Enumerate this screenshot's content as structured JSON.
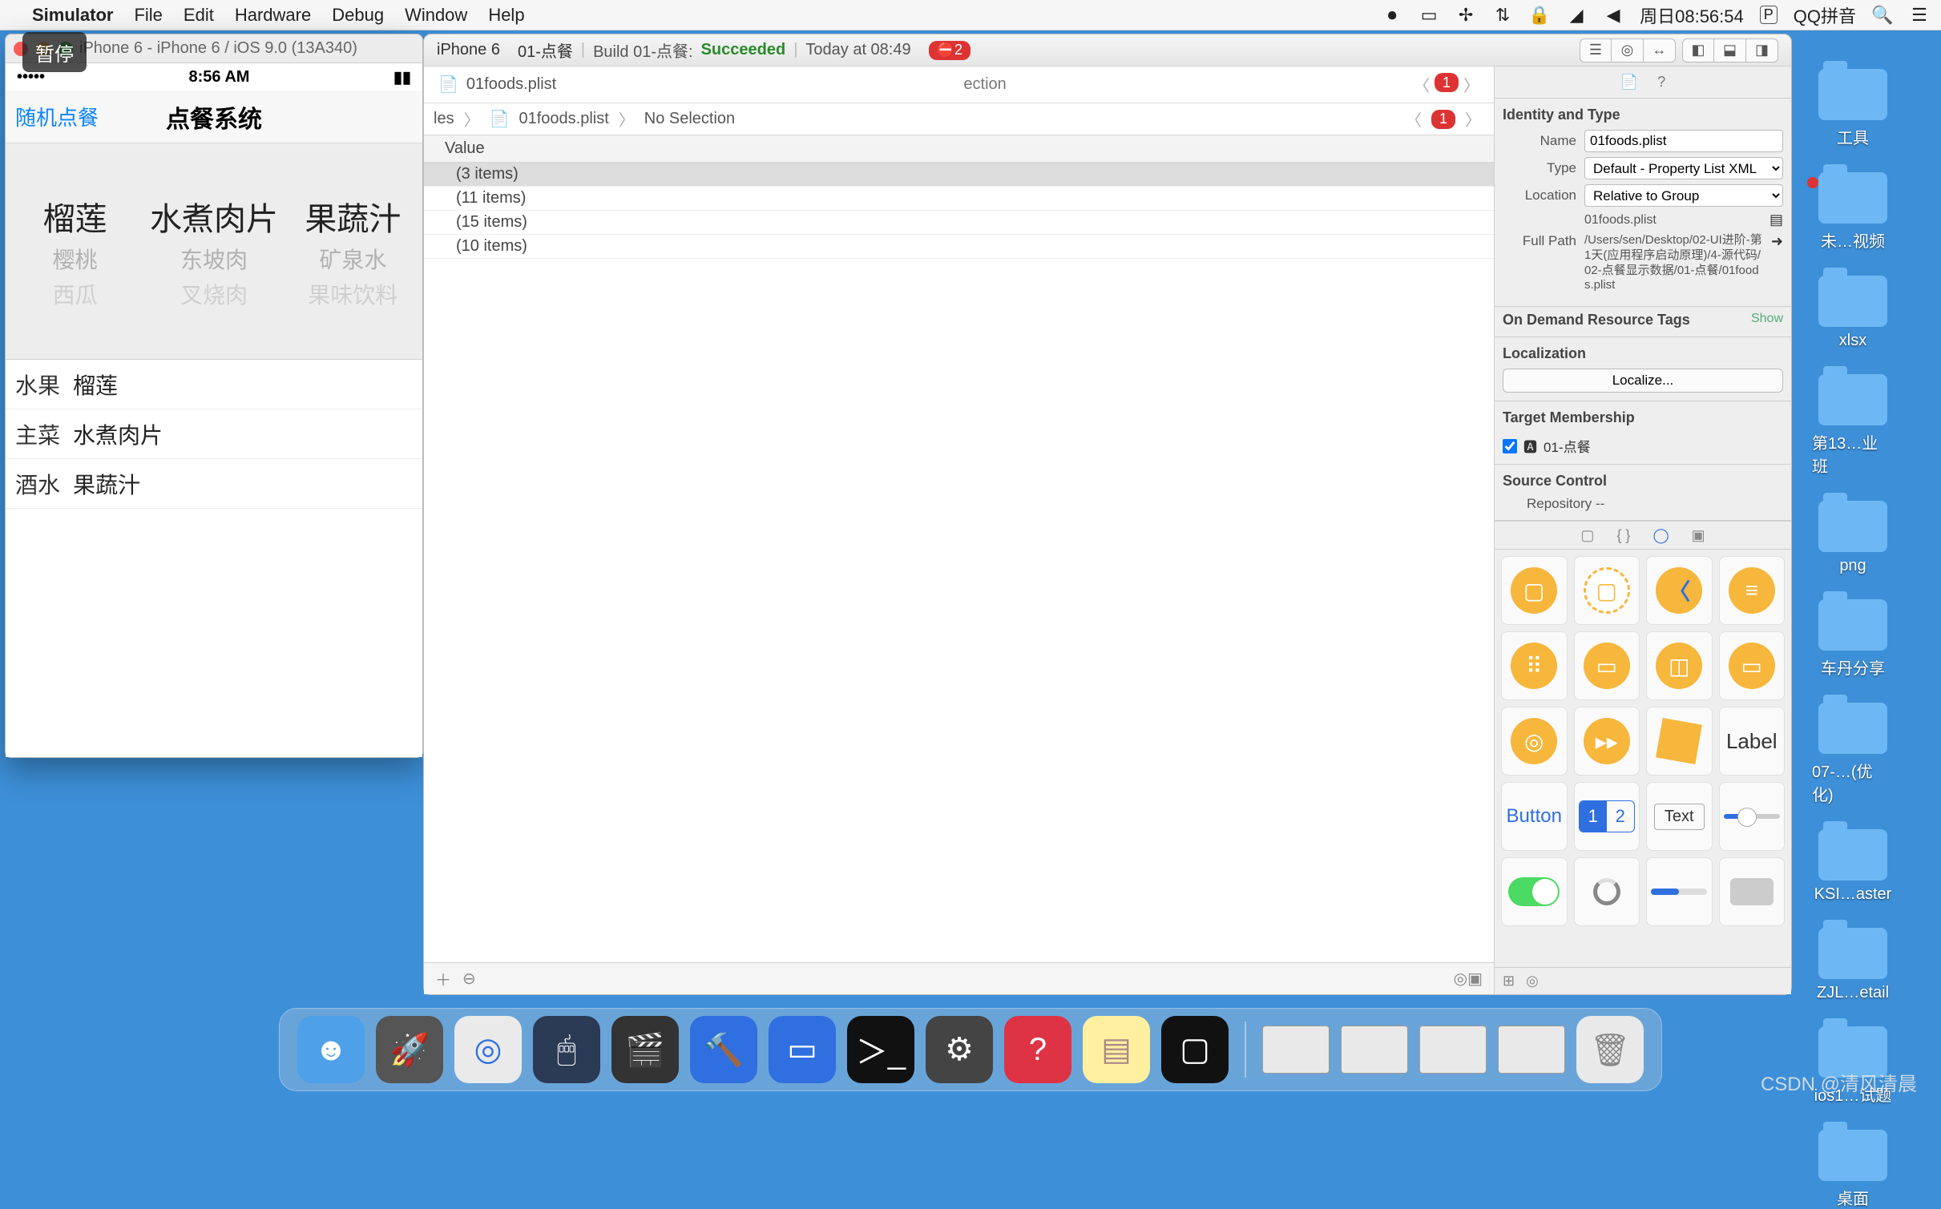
{
  "menubar": {
    "app": "Simulator",
    "items": [
      "File",
      "Edit",
      "Hardware",
      "Debug",
      "Window",
      "Help"
    ],
    "clock": "周日08:56:54",
    "ime_badge": "P",
    "ime": "QQ拼音"
  },
  "simulator": {
    "title": "iPhone 6 - iPhone 6 / iOS 9.0 (13A340)",
    "status_time": "8:56 AM",
    "nav_back": "随机点餐",
    "nav_title": "点餐系统",
    "picker": {
      "col1": {
        "sel": "榴莲",
        "f1": "樱桃",
        "f2": "西瓜"
      },
      "col2": {
        "sel": "水煮肉片",
        "f1": "东坡肉",
        "f2": "叉烧肉"
      },
      "col3": {
        "sel": "果蔬汁",
        "f1": "矿泉水",
        "f2": "果味饮料"
      }
    },
    "rows": [
      {
        "k": "水果",
        "v": "榴莲"
      },
      {
        "k": "主菜",
        "v": "水煮肉片"
      },
      {
        "k": "酒水",
        "v": "果蔬汁"
      }
    ]
  },
  "overlay_pause": "暂停",
  "xcode": {
    "device": "iPhone 6",
    "scheme": "01-点餐",
    "build": "Build 01-点餐:",
    "status": "Succeeded",
    "time": "Today at 08:49",
    "err_count": "2",
    "tab_file": "01foods.plist",
    "breadcrumb": {
      "a": "les",
      "b": "01foods.plist",
      "c": "No Selection"
    },
    "bc_err": "1",
    "plist_header": "Value",
    "plist": [
      "(3 items)",
      "(11 items)",
      "(15 items)",
      "(10 items)"
    ],
    "extra_tab": "ection"
  },
  "inspector": {
    "identity_h": "Identity and Type",
    "name_lbl": "Name",
    "name_val": "01foods.plist",
    "type_lbl": "Type",
    "type_val": "Default - Property List XML",
    "loc_lbl": "Location",
    "loc_val": "Relative to Group",
    "loc_sub": "01foods.plist",
    "fp_lbl": "Full Path",
    "fp_val": "/Users/sen/Desktop/02-UI进阶-第1天(应用程序启动原理)/4-源代码/02-点餐显示数据/01-点餐/01foods.plist",
    "odr_h": "On Demand Resource Tags",
    "odr_show": "Show",
    "loc2_h": "Localization",
    "loc_btn": "Localize...",
    "tm_h": "Target Membership",
    "tm_item": "01-点餐",
    "sc_h": "Source Control",
    "sc_rep": "Repository  --"
  },
  "library": {
    "button": "Button",
    "label": "Label",
    "text": "Text",
    "seg1": "1",
    "seg2": "2"
  },
  "desktop_icons": [
    "工具",
    "未…视频",
    "xlsx",
    "第13…业班",
    "png",
    "车丹分享",
    "07-…(优化)",
    "KSI…aster",
    "ZJL…etail",
    "ios1…试题",
    "桌面"
  ],
  "watermark": "CSDN @清风清晨"
}
